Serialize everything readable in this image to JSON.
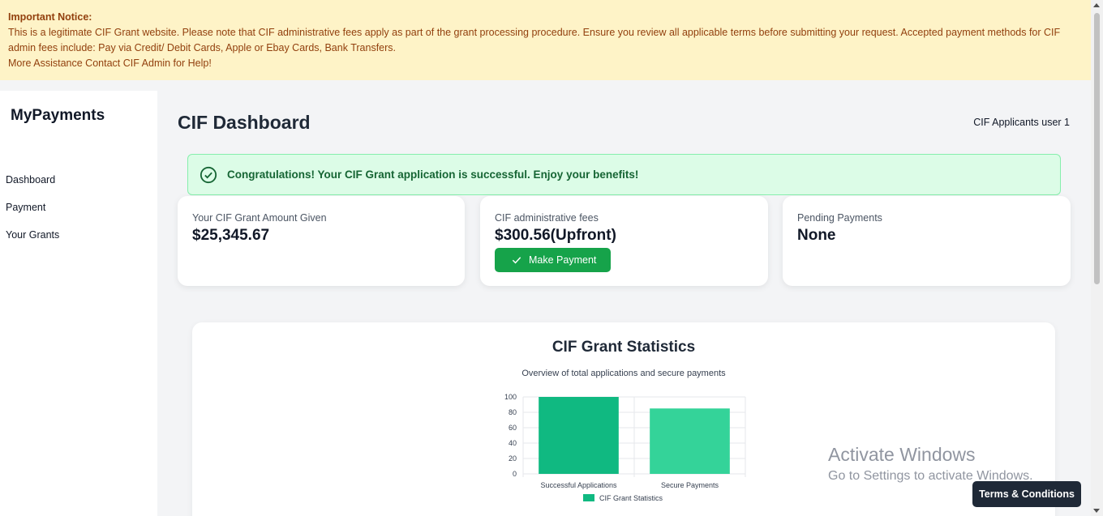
{
  "notice": {
    "title": "Important Notice:",
    "line1": "This is a legitimate CIF Grant website. Please note that CIF administrative fees apply as part of the grant processing procedure. Ensure you review all applicable terms before submitting your request. Accepted payment methods for CIF admin fees include: Pay via Credit/ Debit Cards, Apple or Ebay Cards, Bank Transfers.",
    "line2": "More Assistance Contact CIF Admin for Help!"
  },
  "sidebar": {
    "brand": "MyPayments",
    "items": [
      {
        "label": "Dashboard"
      },
      {
        "label": "Payment"
      },
      {
        "label": "Your Grants"
      }
    ]
  },
  "header": {
    "title": "CIF Dashboard",
    "user": "CIF Applicants user 1"
  },
  "alert": {
    "message": "Congratulations! Your CIF Grant application is successful. Enjoy your benefits!"
  },
  "cards": {
    "grant": {
      "label": "Your CIF Grant Amount Given",
      "value": "$25,345.67"
    },
    "fees": {
      "label": "CIF administrative fees",
      "value": "$300.56(Upfront)",
      "button": "Make Payment"
    },
    "pending": {
      "label": "Pending Payments",
      "value": "None"
    }
  },
  "stats": {
    "title": "CIF Grant Statistics",
    "subtitle": "Overview of total applications and secure payments"
  },
  "chart_data": {
    "type": "bar",
    "categories": [
      "Successful Applications",
      "Secure Payments"
    ],
    "series": [
      {
        "name": "CIF Grant Statistics",
        "values": [
          100,
          85
        ]
      }
    ],
    "yticks": [
      "0",
      "20",
      "40",
      "60",
      "80",
      "100"
    ],
    "ylim": [
      0,
      100
    ],
    "grid": true,
    "legend": "bottom",
    "colors": [
      "#10b981",
      "#34d399"
    ]
  },
  "watermark": {
    "line1": "Activate Windows",
    "line2": "Go to Settings to activate Windows."
  },
  "terms_label": "Terms & Conditions",
  "colors": {
    "notice_bg": "#fef3c7",
    "notice_text": "#92400e",
    "success_bg": "#dcfce7",
    "success_text": "#166534",
    "primary_button": "#16a34a",
    "dark_button": "#1f2937"
  }
}
